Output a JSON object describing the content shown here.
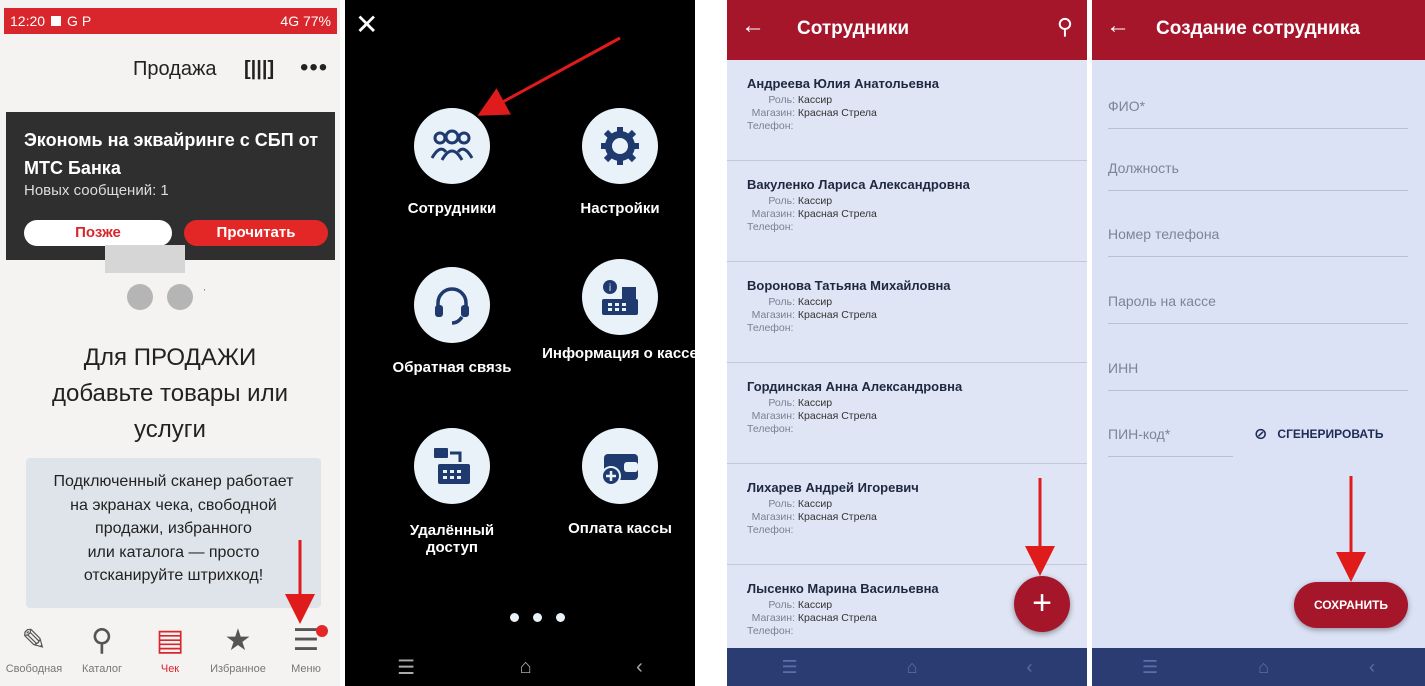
{
  "panel1": {
    "status": {
      "time": "12:20",
      "icons": "G P",
      "right": "4G 77%"
    },
    "header": {
      "title": "Продажа"
    },
    "promo": {
      "title": "Экономь на эквайринге с СБП от МТС Банка",
      "count": "Новых сообщений: 1",
      "later": "Позже",
      "read": "Прочитать"
    },
    "headline": [
      "Для ПРОДАЖИ",
      "добавьте товары или",
      "услуги"
    ],
    "info": [
      "Подключенный сканер работает",
      "на экранах чека, свободной",
      "продажи, избранного",
      "или каталога — просто",
      "отсканируйте штрихкод!"
    ],
    "tabs": [
      {
        "label": "Свободная",
        "icon": "pencil-icon"
      },
      {
        "label": "Каталог",
        "icon": "search-icon"
      },
      {
        "label": "Чек",
        "icon": "receipt-icon"
      },
      {
        "label": "Избранное",
        "icon": "star-icon"
      },
      {
        "label": "Меню",
        "icon": "menu-icon"
      }
    ],
    "accent": "#d8262c"
  },
  "panel2": {
    "menu": [
      {
        "label": "Сотрудники",
        "icon": "users-icon"
      },
      {
        "label": "Настройки",
        "icon": "gear-icon"
      },
      {
        "label": "Обратная связь",
        "icon": "headset-icon"
      },
      {
        "label": "Информация о кассе",
        "icon": "register-info-icon"
      },
      {
        "label": "Удалённый доступ",
        "icon": "remote-access-icon"
      },
      {
        "label": "Оплата кассы",
        "icon": "wallet-add-icon"
      }
    ]
  },
  "panel3": {
    "title": "Сотрудники",
    "labels": {
      "role": "Роль:",
      "store": "Магазин:",
      "phone": "Телефон:"
    },
    "employees": [
      {
        "name": "Андреева Юлия Анатольевна",
        "role": "Кассир",
        "store": "Красная Стрела"
      },
      {
        "name": "Вакуленко Лариса Александровна",
        "role": "Кассир",
        "store": "Красная Стрела"
      },
      {
        "name": "Воронова Татьяна Михайловна",
        "role": "Кассир",
        "store": "Красная Стрела"
      },
      {
        "name": "Гординская Анна Александровна",
        "role": "Кассир",
        "store": "Красная Стрела"
      },
      {
        "name": "Лихарев Андрей Игоревич",
        "role": "Кассир",
        "store": "Красная Стрела"
      },
      {
        "name": "Лысенко Марина Васильевна",
        "role": "Кассир",
        "store": "Красная Стрела"
      }
    ],
    "accent": "#a5162b"
  },
  "panel4": {
    "title": "Создание сотрудника",
    "fields": [
      "ФИО*",
      "Должность",
      "Номер телефона",
      "Пароль на кассе",
      "ИНН",
      "ПИН-код*"
    ],
    "generate": "СГЕНЕРИРОВАТЬ",
    "save": "СОХРАНИТЬ"
  }
}
